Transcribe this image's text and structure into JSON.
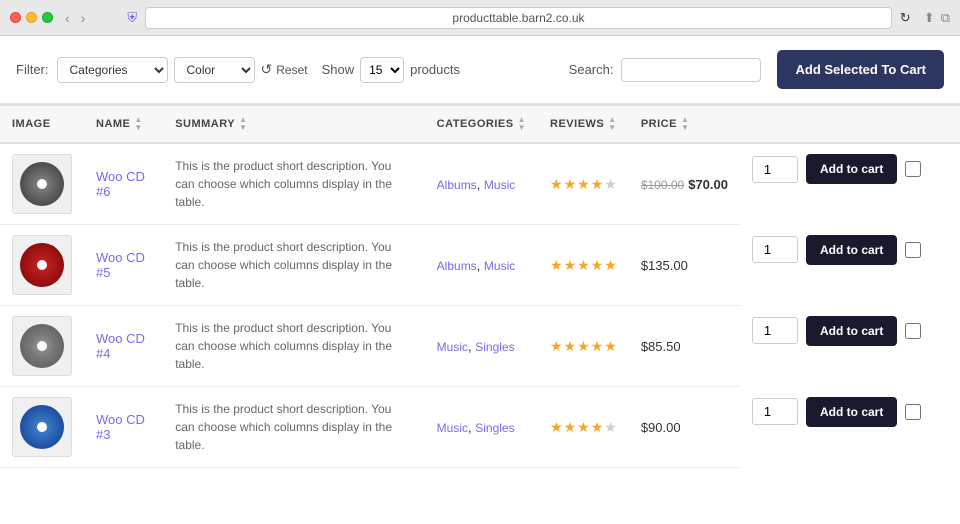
{
  "browser": {
    "url": "producttable.barn2.co.uk",
    "shield": "⛨"
  },
  "toolbar": {
    "filter_label": "Filter:",
    "filter_categories_label": "Categories",
    "filter_color_label": "Color",
    "reset_label": "Reset",
    "show_label": "Show",
    "show_value": "15",
    "products_label": "products",
    "search_label": "Search:",
    "search_placeholder": "",
    "add_selected_label": "Add Selected To Cart"
  },
  "table": {
    "columns": [
      {
        "id": "image",
        "label": "IMAGE",
        "sortable": false
      },
      {
        "id": "name",
        "label": "NAME",
        "sortable": true
      },
      {
        "id": "summary",
        "label": "SUMMARY",
        "sortable": true
      },
      {
        "id": "categories",
        "label": "CATEGORIES",
        "sortable": true
      },
      {
        "id": "reviews",
        "label": "REVIEWS",
        "sortable": true
      },
      {
        "id": "price",
        "label": "PRICE",
        "sortable": true
      },
      {
        "id": "action",
        "label": "",
        "sortable": false
      }
    ],
    "rows": [
      {
        "id": 6,
        "name": "Woo CD #6",
        "summary": "This is the product short description. You can choose which columns display in the table.",
        "categories": "Albums, Music",
        "category_links": [
          "Albums",
          "Music"
        ],
        "reviews_filled": 4,
        "reviews_total": 5,
        "price_original": "$100.00",
        "price_sale": "$70.00",
        "price_only": null,
        "qty": 1,
        "add_to_cart": "Add to cart",
        "cd_class": "cd-6"
      },
      {
        "id": 5,
        "name": "Woo CD #5",
        "summary": "This is the product short description. You can choose which columns display in the table.",
        "categories": "Albums, Music",
        "category_links": [
          "Albums",
          "Music"
        ],
        "reviews_filled": 5,
        "reviews_total": 5,
        "price_original": null,
        "price_sale": null,
        "price_only": "$135.00",
        "qty": 1,
        "add_to_cart": "Add to cart",
        "cd_class": "cd-5"
      },
      {
        "id": 4,
        "name": "Woo CD #4",
        "summary": "This is the product short description. You can choose which columns display in the table.",
        "categories": "Music, Singles",
        "category_links": [
          "Music",
          "Singles"
        ],
        "reviews_filled": 5,
        "reviews_total": 5,
        "price_original": null,
        "price_sale": null,
        "price_only": "$85.50",
        "qty": 1,
        "add_to_cart": "Add to cart",
        "cd_class": "cd-4"
      },
      {
        "id": 3,
        "name": "Woo CD #3",
        "summary": "This is the product short description. You can choose which columns display in the table.",
        "categories": "Music, Singles",
        "category_links": [
          "Music",
          "Singles"
        ],
        "reviews_filled": 4,
        "reviews_total": 5,
        "price_original": null,
        "price_sale": null,
        "price_only": "$90.00",
        "qty": 1,
        "add_to_cart": "Add to cart",
        "cd_class": "cd-3"
      }
    ]
  }
}
